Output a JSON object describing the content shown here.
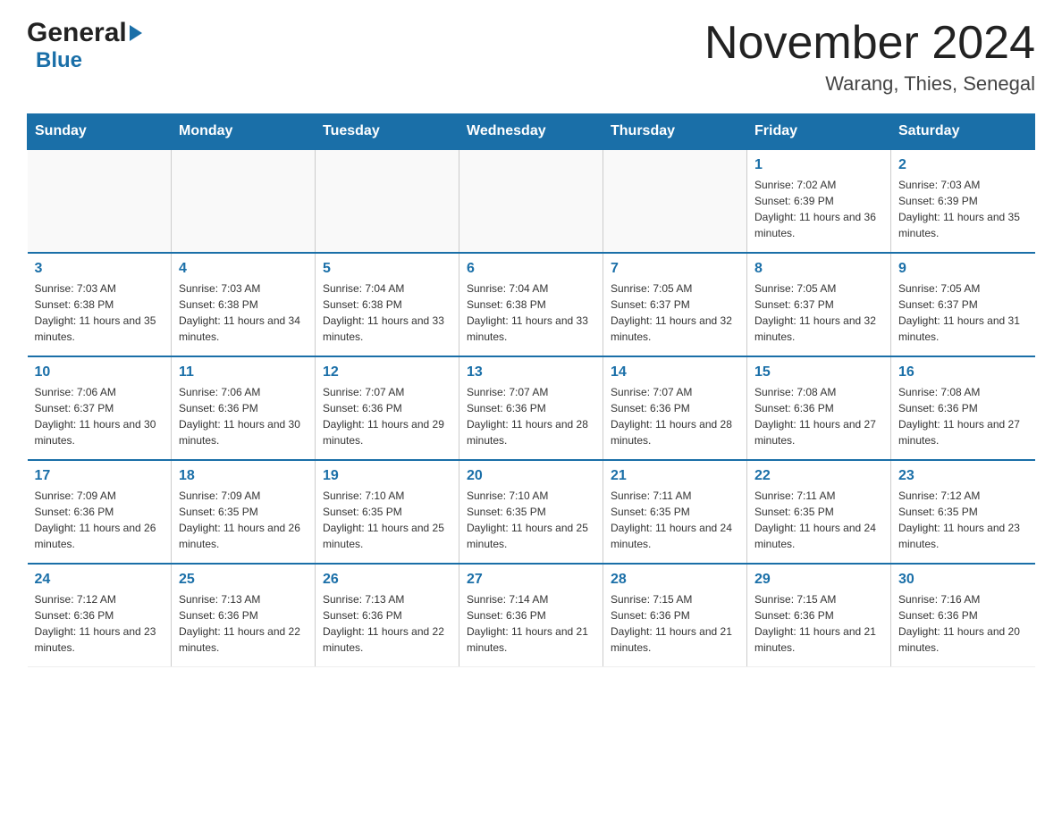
{
  "header": {
    "logo_general": "General",
    "logo_blue": "Blue",
    "title": "November 2024",
    "subtitle": "Warang, Thies, Senegal"
  },
  "days_of_week": [
    "Sunday",
    "Monday",
    "Tuesday",
    "Wednesday",
    "Thursday",
    "Friday",
    "Saturday"
  ],
  "weeks": [
    [
      {
        "day": "",
        "info": ""
      },
      {
        "day": "",
        "info": ""
      },
      {
        "day": "",
        "info": ""
      },
      {
        "day": "",
        "info": ""
      },
      {
        "day": "",
        "info": ""
      },
      {
        "day": "1",
        "info": "Sunrise: 7:02 AM\nSunset: 6:39 PM\nDaylight: 11 hours and 36 minutes."
      },
      {
        "day": "2",
        "info": "Sunrise: 7:03 AM\nSunset: 6:39 PM\nDaylight: 11 hours and 35 minutes."
      }
    ],
    [
      {
        "day": "3",
        "info": "Sunrise: 7:03 AM\nSunset: 6:38 PM\nDaylight: 11 hours and 35 minutes."
      },
      {
        "day": "4",
        "info": "Sunrise: 7:03 AM\nSunset: 6:38 PM\nDaylight: 11 hours and 34 minutes."
      },
      {
        "day": "5",
        "info": "Sunrise: 7:04 AM\nSunset: 6:38 PM\nDaylight: 11 hours and 33 minutes."
      },
      {
        "day": "6",
        "info": "Sunrise: 7:04 AM\nSunset: 6:38 PM\nDaylight: 11 hours and 33 minutes."
      },
      {
        "day": "7",
        "info": "Sunrise: 7:05 AM\nSunset: 6:37 PM\nDaylight: 11 hours and 32 minutes."
      },
      {
        "day": "8",
        "info": "Sunrise: 7:05 AM\nSunset: 6:37 PM\nDaylight: 11 hours and 32 minutes."
      },
      {
        "day": "9",
        "info": "Sunrise: 7:05 AM\nSunset: 6:37 PM\nDaylight: 11 hours and 31 minutes."
      }
    ],
    [
      {
        "day": "10",
        "info": "Sunrise: 7:06 AM\nSunset: 6:37 PM\nDaylight: 11 hours and 30 minutes."
      },
      {
        "day": "11",
        "info": "Sunrise: 7:06 AM\nSunset: 6:36 PM\nDaylight: 11 hours and 30 minutes."
      },
      {
        "day": "12",
        "info": "Sunrise: 7:07 AM\nSunset: 6:36 PM\nDaylight: 11 hours and 29 minutes."
      },
      {
        "day": "13",
        "info": "Sunrise: 7:07 AM\nSunset: 6:36 PM\nDaylight: 11 hours and 28 minutes."
      },
      {
        "day": "14",
        "info": "Sunrise: 7:07 AM\nSunset: 6:36 PM\nDaylight: 11 hours and 28 minutes."
      },
      {
        "day": "15",
        "info": "Sunrise: 7:08 AM\nSunset: 6:36 PM\nDaylight: 11 hours and 27 minutes."
      },
      {
        "day": "16",
        "info": "Sunrise: 7:08 AM\nSunset: 6:36 PM\nDaylight: 11 hours and 27 minutes."
      }
    ],
    [
      {
        "day": "17",
        "info": "Sunrise: 7:09 AM\nSunset: 6:36 PM\nDaylight: 11 hours and 26 minutes."
      },
      {
        "day": "18",
        "info": "Sunrise: 7:09 AM\nSunset: 6:35 PM\nDaylight: 11 hours and 26 minutes."
      },
      {
        "day": "19",
        "info": "Sunrise: 7:10 AM\nSunset: 6:35 PM\nDaylight: 11 hours and 25 minutes."
      },
      {
        "day": "20",
        "info": "Sunrise: 7:10 AM\nSunset: 6:35 PM\nDaylight: 11 hours and 25 minutes."
      },
      {
        "day": "21",
        "info": "Sunrise: 7:11 AM\nSunset: 6:35 PM\nDaylight: 11 hours and 24 minutes."
      },
      {
        "day": "22",
        "info": "Sunrise: 7:11 AM\nSunset: 6:35 PM\nDaylight: 11 hours and 24 minutes."
      },
      {
        "day": "23",
        "info": "Sunrise: 7:12 AM\nSunset: 6:35 PM\nDaylight: 11 hours and 23 minutes."
      }
    ],
    [
      {
        "day": "24",
        "info": "Sunrise: 7:12 AM\nSunset: 6:36 PM\nDaylight: 11 hours and 23 minutes."
      },
      {
        "day": "25",
        "info": "Sunrise: 7:13 AM\nSunset: 6:36 PM\nDaylight: 11 hours and 22 minutes."
      },
      {
        "day": "26",
        "info": "Sunrise: 7:13 AM\nSunset: 6:36 PM\nDaylight: 11 hours and 22 minutes."
      },
      {
        "day": "27",
        "info": "Sunrise: 7:14 AM\nSunset: 6:36 PM\nDaylight: 11 hours and 21 minutes."
      },
      {
        "day": "28",
        "info": "Sunrise: 7:15 AM\nSunset: 6:36 PM\nDaylight: 11 hours and 21 minutes."
      },
      {
        "day": "29",
        "info": "Sunrise: 7:15 AM\nSunset: 6:36 PM\nDaylight: 11 hours and 21 minutes."
      },
      {
        "day": "30",
        "info": "Sunrise: 7:16 AM\nSunset: 6:36 PM\nDaylight: 11 hours and 20 minutes."
      }
    ]
  ]
}
